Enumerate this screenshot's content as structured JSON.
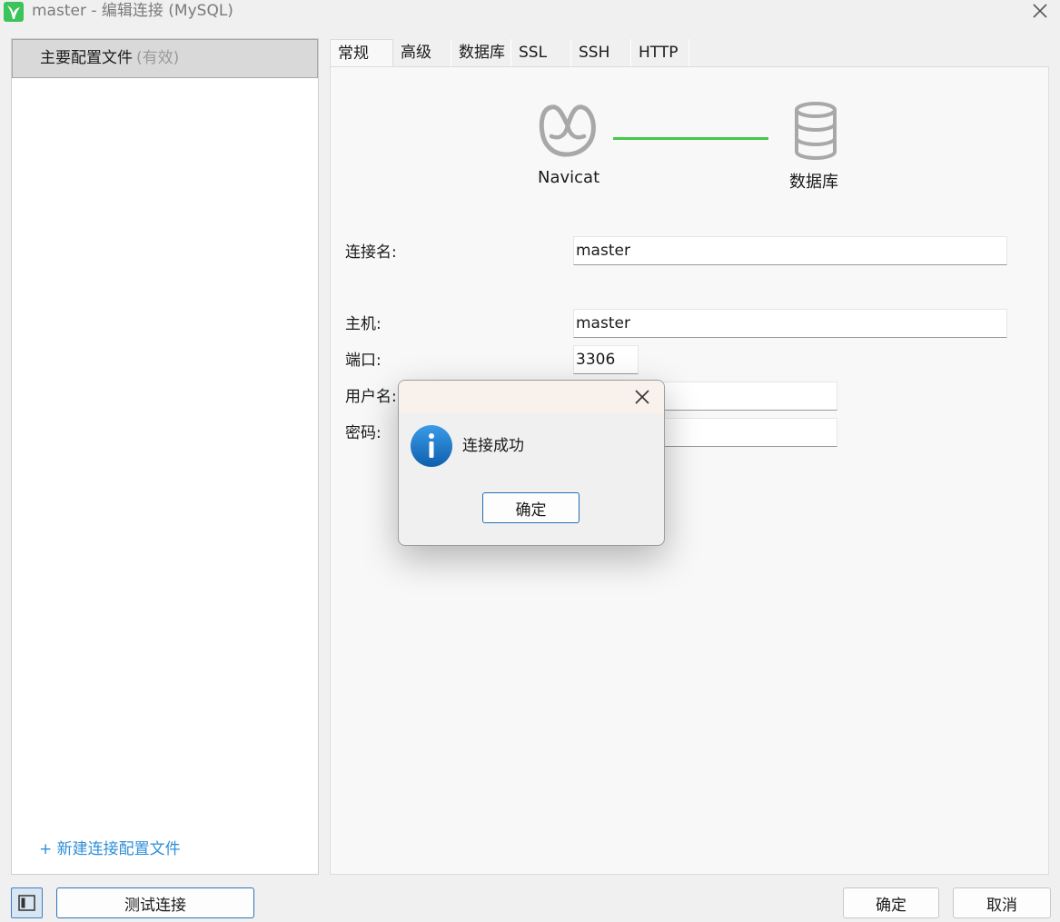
{
  "window": {
    "title": "master - 编辑连接 (MySQL)"
  },
  "sidebar": {
    "profile_name": "主要配置文件",
    "profile_status": "(有效)",
    "new_profile_link": "+ 新建连接配置文件"
  },
  "tabs": [
    {
      "label": "常规",
      "active": true
    },
    {
      "label": "高级",
      "active": false
    },
    {
      "label": "数据库",
      "active": false
    },
    {
      "label": "SSL",
      "active": false
    },
    {
      "label": "SSH",
      "active": false
    },
    {
      "label": "HTTP",
      "active": false
    }
  ],
  "diagram": {
    "left_label": "Navicat",
    "right_label": "数据库",
    "line_color": "#45c94a"
  },
  "form": {
    "connection_name_label": "连接名:",
    "connection_name_value": "master",
    "host_label": "主机:",
    "host_value": "master",
    "port_label": "端口:",
    "port_value": "3306",
    "username_label": "用户名:",
    "username_value": "",
    "password_label": "密码:",
    "password_value": ""
  },
  "dialog": {
    "message": "连接成功",
    "ok_label": "确定",
    "icon": "info-icon"
  },
  "footer": {
    "test_button": "测试连接",
    "ok_button": "确定",
    "cancel_button": "取消"
  },
  "colors": {
    "accent": "#2f8fd8",
    "info_blue": "#1a78c9",
    "app_icon_green": "#3cc45a"
  }
}
